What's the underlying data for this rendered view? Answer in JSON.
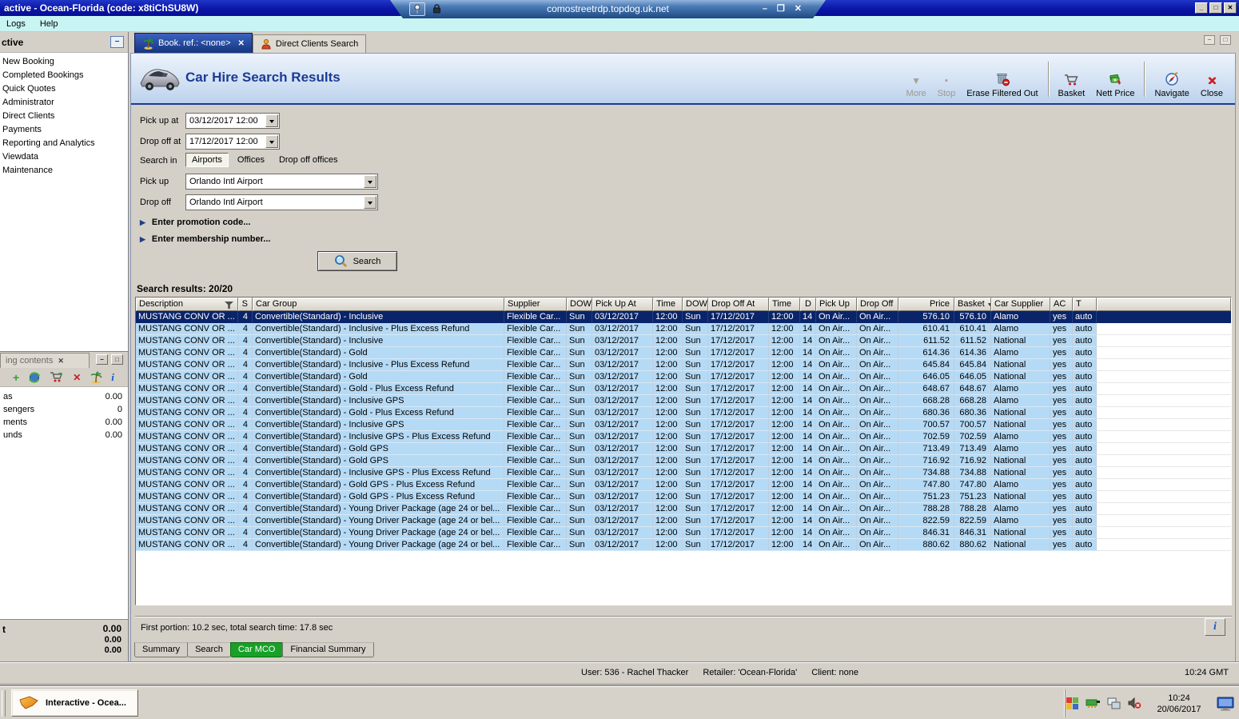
{
  "colors": {
    "selection_navy": "#0A246A",
    "row_blue": "#B5DAF6",
    "accent_navy": "#1B3B94",
    "active_tab_green": "#18A028",
    "titlebar_blue": "#0A16A6"
  },
  "icons": {
    "minimize": "_",
    "maximize": "□",
    "close_x": "✕",
    "rdp_minimize": "–",
    "rdp_restore": "❐",
    "down_triangle": "▼",
    "stop_square": "▪",
    "expand_arrow": "▶",
    "collapse_minus": "−",
    "info": "i",
    "plus": "+"
  },
  "titlebar": {
    "title": "active - Ocean-Florida (code: x8tiChSU8W)"
  },
  "rdp_bar": {
    "address": "comostreetrdp.topdog.uk.net"
  },
  "menubar": {
    "items": [
      "Logs",
      "Help"
    ]
  },
  "sidebar": {
    "header": "ctive",
    "items": [
      "New Booking",
      "Completed Bookings",
      "Quick Quotes",
      "Administrator",
      "Direct Clients",
      "Payments",
      "Reporting and Analytics",
      "Viewdata",
      "Maintenance"
    ]
  },
  "contents_panel": {
    "tab": "ing contents",
    "rows": [
      [
        "as",
        "0.00"
      ],
      [
        "sengers",
        "0"
      ],
      [
        "ments",
        "0.00"
      ],
      [
        "unds",
        "0.00"
      ]
    ],
    "totals_label": "t",
    "totals": [
      "0.00",
      "0.00",
      "0.00"
    ]
  },
  "tabs": {
    "booking": "Book. ref.: <none>",
    "direct": "Direct Clients Search"
  },
  "page": {
    "title": "Car Hire Search Results"
  },
  "toolbar": {
    "more": "More",
    "stop": "Stop",
    "erase": "Erase Filtered Out",
    "basket": "Basket",
    "nett_price": "Nett Price",
    "navigate": "Navigate",
    "close": "Close"
  },
  "form": {
    "pick_up_at_label": "Pick up at",
    "pick_up_at_value": "03/12/2017 12:00",
    "drop_off_at_label": "Drop off at",
    "drop_off_at_value": "17/12/2017 12:00",
    "search_in_label": "Search in",
    "search_in_options": [
      "Airports",
      "Offices",
      "Drop off offices"
    ],
    "search_in_selected": "Airports",
    "pick_up_label": "Pick up",
    "pick_up_value": "Orlando Intl Airport",
    "drop_off_label": "Drop off",
    "drop_off_value": "Orlando Intl Airport",
    "promotion_toggle": "Enter promotion code...",
    "membership_toggle": "Enter membership number...",
    "search_button": "Search"
  },
  "results": {
    "summary": "Search results: 20/20",
    "columns": [
      "Description",
      "S",
      "Car Group",
      "Supplier",
      "DOW",
      "Pick Up At",
      "Time",
      "DOW",
      "Drop Off At",
      "Time",
      "D",
      "Pick Up",
      "Drop Off",
      "Price",
      "Basket",
      "Car Supplier",
      "AC",
      "T",
      ""
    ],
    "common": {
      "description": "MUSTANG CONV OR ...",
      "s": "4",
      "supplier": "Flexible Car...",
      "dow_pick": "Sun",
      "pick_up_at": "03/12/2017",
      "pick_time": "12:00",
      "dow_drop": "Sun",
      "drop_off_at": "17/12/2017",
      "drop_time": "12:00",
      "days": "14",
      "pick_up": "On Air...",
      "drop_off": "On Air...",
      "ac": "yes",
      "transmission": "auto"
    },
    "selected_index": 0,
    "rows": [
      {
        "car_group": "Convertible(Standard) - Inclusive",
        "price": "576.10",
        "basket": "576.10",
        "car_supplier": "Alamo"
      },
      {
        "car_group": "Convertible(Standard) - Inclusive - Plus Excess Refund",
        "price": "610.41",
        "basket": "610.41",
        "car_supplier": "Alamo"
      },
      {
        "car_group": "Convertible(Standard) - Inclusive",
        "price": "611.52",
        "basket": "611.52",
        "car_supplier": "National"
      },
      {
        "car_group": "Convertible(Standard) - Gold",
        "price": "614.36",
        "basket": "614.36",
        "car_supplier": "Alamo"
      },
      {
        "car_group": "Convertible(Standard) - Inclusive - Plus Excess Refund",
        "price": "645.84",
        "basket": "645.84",
        "car_supplier": "National"
      },
      {
        "car_group": "Convertible(Standard) - Gold",
        "price": "646.05",
        "basket": "646.05",
        "car_supplier": "National"
      },
      {
        "car_group": "Convertible(Standard) - Gold - Plus Excess Refund",
        "price": "648.67",
        "basket": "648.67",
        "car_supplier": "Alamo"
      },
      {
        "car_group": "Convertible(Standard) - Inclusive GPS",
        "price": "668.28",
        "basket": "668.28",
        "car_supplier": "Alamo"
      },
      {
        "car_group": "Convertible(Standard) - Gold - Plus Excess Refund",
        "price": "680.36",
        "basket": "680.36",
        "car_supplier": "National"
      },
      {
        "car_group": "Convertible(Standard) - Inclusive GPS",
        "price": "700.57",
        "basket": "700.57",
        "car_supplier": "National"
      },
      {
        "car_group": "Convertible(Standard) - Inclusive GPS - Plus Excess Refund",
        "price": "702.59",
        "basket": "702.59",
        "car_supplier": "Alamo"
      },
      {
        "car_group": "Convertible(Standard) - Gold GPS",
        "price": "713.49",
        "basket": "713.49",
        "car_supplier": "Alamo"
      },
      {
        "car_group": "Convertible(Standard) - Gold GPS",
        "price": "716.92",
        "basket": "716.92",
        "car_supplier": "National"
      },
      {
        "car_group": "Convertible(Standard) - Inclusive GPS - Plus Excess Refund",
        "price": "734.88",
        "basket": "734.88",
        "car_supplier": "National"
      },
      {
        "car_group": "Convertible(Standard) - Gold GPS - Plus Excess Refund",
        "price": "747.80",
        "basket": "747.80",
        "car_supplier": "Alamo"
      },
      {
        "car_group": "Convertible(Standard) - Gold GPS - Plus Excess Refund",
        "price": "751.23",
        "basket": "751.23",
        "car_supplier": "National"
      },
      {
        "car_group": "Convertible(Standard) - Young Driver Package (age 24 or bel...",
        "price": "788.28",
        "basket": "788.28",
        "car_supplier": "Alamo"
      },
      {
        "car_group": "Convertible(Standard) - Young Driver Package (age 24 or bel...",
        "price": "822.59",
        "basket": "822.59",
        "car_supplier": "Alamo"
      },
      {
        "car_group": "Convertible(Standard) - Young Driver Package (age 24 or bel...",
        "price": "846.31",
        "basket": "846.31",
        "car_supplier": "National"
      },
      {
        "car_group": "Convertible(Standard) - Young Driver Package (age 24 or bel...",
        "price": "880.62",
        "basket": "880.62",
        "car_supplier": "National"
      }
    ]
  },
  "footer": {
    "timing": "First portion: 10.2 sec, total search time: 17.8 sec",
    "tabs": [
      "Summary",
      "Search",
      "Car MCO",
      "Financial Summary"
    ],
    "active_tab_index": 2
  },
  "statusbar": {
    "user": "User: 536 - Rachel Thacker",
    "retailer": "Retailer: 'Ocean-Florida'",
    "client": "Client: none",
    "time": "10:24 GMT"
  },
  "taskbar": {
    "app_button": "Interactive - Ocea...",
    "clock_time": "10:24",
    "clock_date": "20/06/2017"
  }
}
